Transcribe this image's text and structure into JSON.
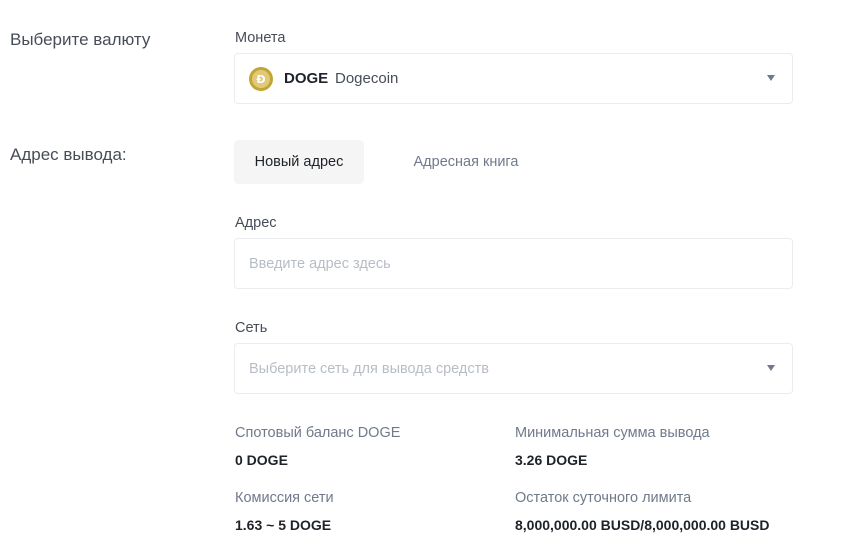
{
  "currency_section": {
    "label": "Выберите валюту",
    "coin_field_label": "Монета",
    "selected_coin": {
      "icon_glyph": "Ð",
      "symbol": "DOGE",
      "name": "Dogecoin"
    }
  },
  "address_section": {
    "label": "Адрес вывода:",
    "tabs": [
      {
        "label": "Новый адрес",
        "active": true
      },
      {
        "label": "Адресная книга",
        "active": false
      }
    ],
    "address_field": {
      "label": "Адрес",
      "placeholder": "Введите адрес здесь",
      "value": ""
    },
    "network_field": {
      "label": "Сеть",
      "placeholder": "Выберите сеть для вывода средств"
    }
  },
  "info": {
    "spot_balance": {
      "label": "Спотовый баланс DOGE",
      "value": "0 DOGE"
    },
    "min_withdrawal": {
      "label": "Минимальная сумма вывода",
      "value": "3.26 DOGE"
    },
    "network_fee": {
      "label": "Комиссия сети",
      "value": "1.63 ~ 5 DOGE"
    },
    "daily_limit_remaining": {
      "label": "Остаток суточного лимита",
      "value": "8,000,000.00 BUSD/8,000,000.00 BUSD"
    }
  },
  "colors": {
    "doge_brand": "#c2a633",
    "text_primary": "#1e2329",
    "text_secondary": "#707a8a",
    "border": "#eaecef",
    "tab_active_bg": "#f5f5f5"
  }
}
